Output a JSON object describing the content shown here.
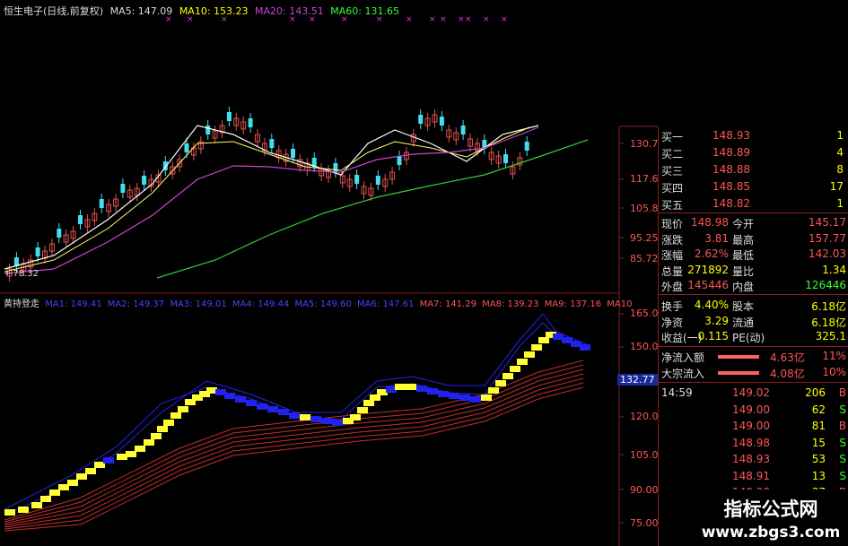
{
  "header": {
    "stock_title": "恒生电子(日线,前复权)",
    "ma5": "MA5: 147.09",
    "ma10": "MA10: 153.23",
    "ma20": "MA20: 143.51",
    "ma60": "MA60: 131.65"
  },
  "indicator_header": {
    "name": "黄持登走",
    "mas": [
      "MA1: 149.41",
      "MA2: 149.37",
      "MA3: 149.01",
      "MA4: 149.44",
      "MA5: 149.60",
      "MA6: 147.61",
      "MA7: 141.29",
      "MA8: 139.23",
      "MA9: 137.16",
      "MA10"
    ]
  },
  "price_axis": [
    "130.7",
    "117.6",
    "105.8",
    "95.25",
    "85.72"
  ],
  "indicator_axis": [
    "165.0",
    "150.0",
    "132.77",
    "120.0",
    "105.0",
    "90.00",
    "75.00"
  ],
  "low_marker": "78.32",
  "colors": {
    "up": "#e05050",
    "down": "#44ddee",
    "ma5": "#ffffff",
    "ma10": "#ffff66",
    "ma20": "#cc44cc",
    "ma60": "#33cc33",
    "ind_yellow": "#ffff33",
    "ind_blue": "#2222ee",
    "ind_red": "#c0302a"
  },
  "order_book": [
    {
      "label": "买一",
      "price": "148.93",
      "vol": "1"
    },
    {
      "label": "买二",
      "price": "148.89",
      "vol": "4"
    },
    {
      "label": "买三",
      "price": "148.88",
      "vol": "8"
    },
    {
      "label": "买四",
      "price": "148.85",
      "vol": "17"
    },
    {
      "label": "买五",
      "price": "148.82",
      "vol": "1"
    }
  ],
  "quote": [
    {
      "l1": "现价",
      "v1": "148.98",
      "l2": "今开",
      "v2": "145.17"
    },
    {
      "l1": "涨跌",
      "v1": "3.81",
      "l2": "最高",
      "v2": "157.77"
    },
    {
      "l1": "涨幅",
      "v1": "2.62%",
      "l2": "最低",
      "v2": "142.03"
    },
    {
      "l1": "总量",
      "v1": "271892",
      "l2": "量比",
      "v2": "1.34"
    },
    {
      "l1": "外盘",
      "v1": "145446",
      "l2": "内盘",
      "v2": "126446"
    }
  ],
  "stats": [
    {
      "l1": "换手",
      "v1": "4.40%",
      "l2": "股本",
      "v2": "6.18亿"
    },
    {
      "l1": "净资",
      "v1": "3.29",
      "l2": "流通",
      "v2": "6.18亿"
    },
    {
      "l1": "收益(一)",
      "v1": "0.115",
      "l2": "PE(动)",
      "v2": "325.1"
    }
  ],
  "flows": [
    {
      "label": "净流入额",
      "value": "4.63亿",
      "pct": "11%"
    },
    {
      "label": "大宗流入",
      "value": "4.08亿",
      "pct": "10%"
    }
  ],
  "ticks": [
    {
      "time": "14:59",
      "price": "149.02",
      "vol": "206",
      "side": "B"
    },
    {
      "time": "",
      "price": "149.00",
      "vol": "62",
      "side": "S"
    },
    {
      "time": "",
      "price": "149.00",
      "vol": "81",
      "side": "B"
    },
    {
      "time": "",
      "price": "148.98",
      "vol": "15",
      "side": "S"
    },
    {
      "time": "",
      "price": "148.93",
      "vol": "53",
      "side": "S"
    },
    {
      "time": "",
      "price": "148.91",
      "vol": "13",
      "side": "S"
    },
    {
      "time": "",
      "price": "148.98",
      "vol": "37",
      "side": "B"
    }
  ],
  "watermark": {
    "line1": "指标公式网",
    "line2": "www.zbgs3.com"
  }
}
